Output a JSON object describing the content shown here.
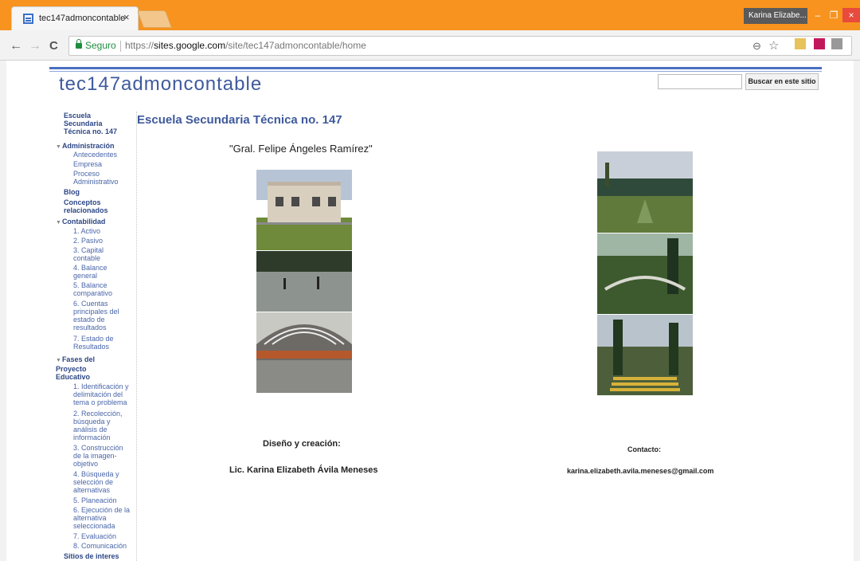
{
  "browser": {
    "tab_title": "tec147admoncontable",
    "tab_close": "×",
    "profile_name": "Karina Elizabe...",
    "window_min": "–",
    "window_max": "❐",
    "window_close": "×",
    "nav_back": "←",
    "nav_forward": "→",
    "nav_reload": "C",
    "secure_label": "Seguro",
    "url_scheme": "https://",
    "url_host": "sites.google.com",
    "url_path": "/site/tec147admoncontable/home",
    "zoom_icon": "⊖",
    "star_icon": "☆"
  },
  "site": {
    "title": "tec147admoncontable",
    "search_button": "Buscar en este sitio",
    "search_placeholder": ""
  },
  "sidebar": {
    "home": "Escuela Secundaria Técnica no. 147",
    "administracion": "Administración",
    "antecedentes": "Antecedentes",
    "empresa": "Empresa",
    "proceso": "Proceso Administrativo",
    "blog": "Blog",
    "conceptos": "Conceptos relacionados",
    "contabilidad": "Contabilidad",
    "activo": "1. Activo",
    "pasivo": "2. Pasivo",
    "capital": "3. Capital contable",
    "balance_general": "4. Balance general",
    "balance_comparativo": "5. Balance comparativo",
    "cuentas": "6. Cuentas principales del estado de resultados",
    "estado": "7. Estado de Resultados",
    "fases": "Fases del Proyecto Educativo",
    "f1": "1. Identificación y delimitación del tema o problema",
    "f2": "2. Recolección, búsqueda y análisis de información",
    "f3": "3. Construcción de la imagen-objetivo",
    "f4": "4. Búsqueda y selección de alternativas",
    "f5": "5. Planeación",
    "f6": "6. Ejecución de la alternativa seleccionada",
    "f7": "7. Evaluación",
    "f8": "8. Comunicación",
    "sitios": "Sitios de interes"
  },
  "content": {
    "page_title": "Escuela Secundaria Técnica no. 147",
    "subtitle": "\"Gral. Felipe Ángeles Ramírez\"",
    "design_label": "Diseño y creación:",
    "designer_name": "Lic. Karina Elizabeth Ávila Meneses",
    "contact_label": "Contacto:",
    "contact_email": "karina.elizabeth.avila.meneses@gmail.com"
  },
  "colors": {
    "chrome_accent": "#f7931e",
    "site_blue": "#3f5a9c",
    "secure_green": "#1e8e3e"
  }
}
